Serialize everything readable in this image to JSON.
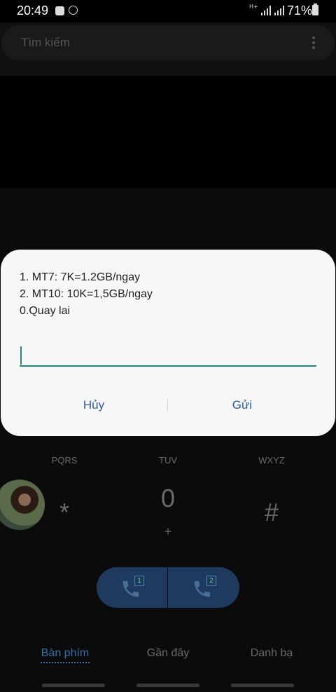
{
  "status_bar": {
    "time": "20:49",
    "network": "H+",
    "battery": "71%"
  },
  "app": {
    "search_placeholder": "Tìm kiếm",
    "keypad": {
      "label_7": "PQRS",
      "label_8": "TUV",
      "label_9": "WXYZ",
      "key_star": "*",
      "key_0": "0",
      "key_0_sub": "+",
      "key_hash": "#"
    },
    "call_buttons": {
      "sim1": "1",
      "sim2": "2"
    },
    "tabs": [
      "Bàn phím",
      "Gần đây",
      "Danh bạ"
    ]
  },
  "dialog": {
    "lines": [
      "1. MT7: 7K=1.2GB/ngay",
      "2. MT10: 10K=1,5GB/ngay",
      "0.Quay lai"
    ],
    "input_value": "",
    "cancel_label": "Hủy",
    "send_label": "Gửi"
  },
  "colors": {
    "accent": "#1e8a80",
    "button_text": "#2b5aa0",
    "call_button": "#1f3a5f"
  }
}
